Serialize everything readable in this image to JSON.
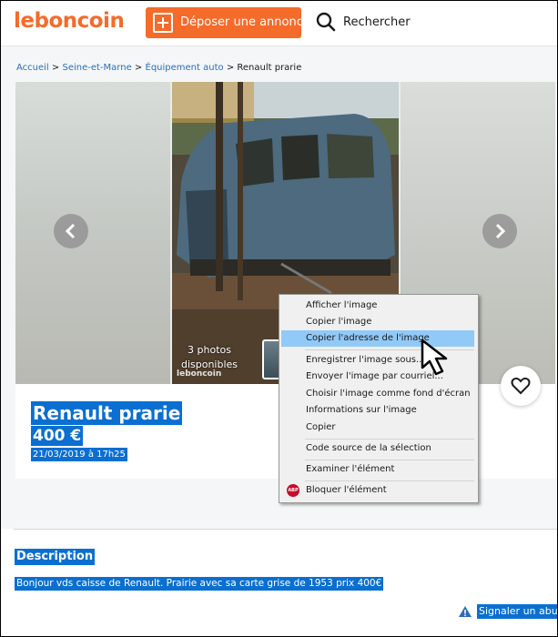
{
  "header": {
    "logo": "leboncoin",
    "post_button": "Déposer une annonce",
    "search_button": "Rechercher"
  },
  "breadcrumb": {
    "items": [
      "Accueil",
      "Seine-et-Marne",
      "Équipement auto"
    ],
    "separator": ">",
    "current": "Renault prarie"
  },
  "gallery": {
    "photo_count_number": "3 photos",
    "photo_count_label": "disponibles",
    "watermark": "leboncoin"
  },
  "ad": {
    "title": "Renault prarie",
    "price": "400 €",
    "date": "21/03/2019 à 17h25"
  },
  "description": {
    "heading": "Description",
    "text": "Bonjour vds caisse de Renault. Prairie avec sa carte grise de 1953 prix 400€"
  },
  "report": {
    "label": "Signaler un abus"
  },
  "context_menu": {
    "items": [
      "Afficher l'image",
      "Copier l'image",
      "Copier l'adresse de l'image",
      "Enregistrer l'image sous...",
      "Envoyer l'image par courriel...",
      "Choisir l'image comme fond d'écran",
      "Informations sur l'image",
      "Copier",
      "Code source de la sélection",
      "Examiner l'élément",
      "Bloquer l'élément"
    ],
    "highlighted_index": 2,
    "abp_badge": "ABP"
  },
  "colors": {
    "brand": "#f56b2a",
    "selection": "#0a6fd0",
    "menu_highlight": "#91c9f7",
    "link": "#2a6ebb"
  }
}
